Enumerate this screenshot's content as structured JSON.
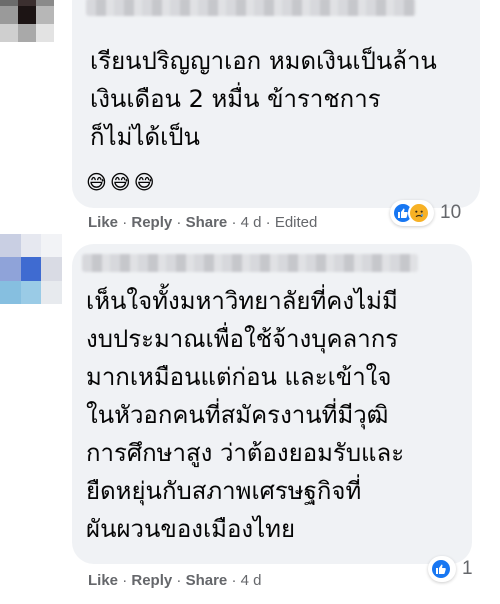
{
  "comments": [
    {
      "text_lines": [
        "เรียนปริญญาเอก หมดเงินเป็นล้าน",
        "เงินเดือน 2 หมื่น ข้าราชการ",
        "ก็ไม่ได้เป็น"
      ],
      "emojis": [
        "😅",
        "😅",
        "😅"
      ],
      "actions": {
        "like": "Like",
        "reply": "Reply",
        "share": "Share",
        "time": "4 d",
        "edited": "Edited"
      },
      "reactions": {
        "icons": [
          "like-icon",
          "sad-icon"
        ],
        "count": "10"
      }
    },
    {
      "text_lines": [
        "เห็นใจทั้งมหาวิทยาลัยที่คงไม่มี",
        "งบประมาณเพื่อใช้จ้างบุคลากร",
        "มากเหมือนแต่ก่อน และเข้าใจ",
        "ในหัวอกคนที่สมัครงานที่มีวุฒิ",
        "การศึกษาสูง ว่าต้องยอมรับและ",
        "ยืดหยุ่นกับสภาพเศรษฐกิจที่",
        "ผันผวนของเมืองไทย"
      ],
      "actions": {
        "like": "Like",
        "reply": "Reply",
        "share": "Share",
        "time": "4 d"
      },
      "reactions": {
        "icons": [
          "like-icon"
        ],
        "count": "1"
      }
    }
  ],
  "colors": {
    "bubble": "#f0f2f5",
    "action_text": "#65676b",
    "like_blue": "#1877f2",
    "sad_yellow": "#f7b125"
  }
}
